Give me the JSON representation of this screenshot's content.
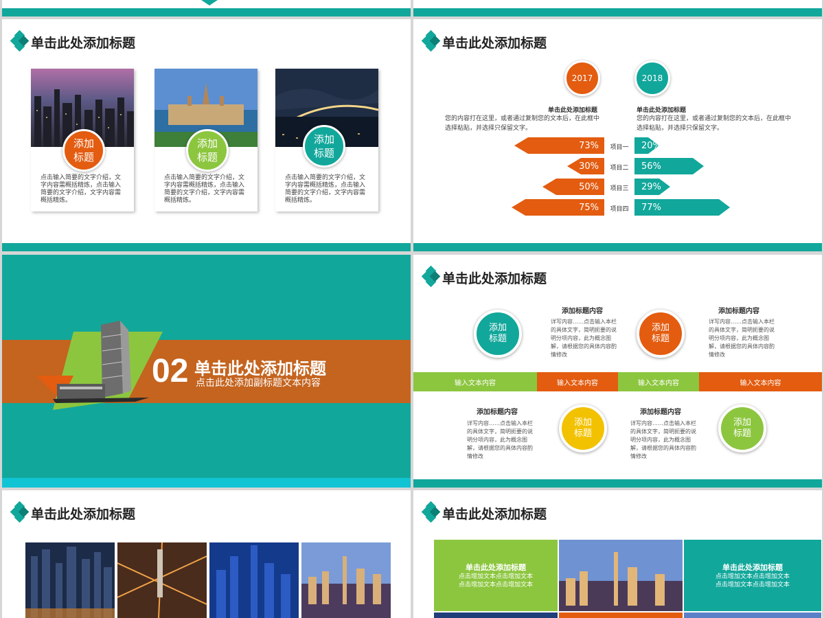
{
  "slide_title": "单击此处添加标题",
  "cards": [
    {
      "badge": "添加\n标题",
      "color": "#e35c10",
      "text": "点击输入简要的文字介绍，文字内容需概括精炼，点击输入简要的文字介绍，文字内容需概括精炼。"
    },
    {
      "badge": "添加\n标题",
      "color": "#8cc63f",
      "text": "点击输入简要的文字介绍，文字内容需概括精炼，点击输入简要的文字介绍，文字内容需概括精炼。"
    },
    {
      "badge": "添加\n标题",
      "color": "#12a79b",
      "text": "点击输入简要的文字介绍，文字内容需概括精炼，点击输入简要的文字介绍，文字内容需概括精炼。"
    }
  ],
  "compare": {
    "year_left": "2017",
    "year_right": "2018",
    "left_title": "单击此处添加标题",
    "right_title": "单击此处添加标题",
    "left_text": "您的内容打在这里，或者通过复制您的文本后，在此框中选择粘贴，并选择只保留文字。",
    "right_text": "您的内容打在这里，或者通过复制您的文本后，在此框中选择粘贴，并选择只保留文字。",
    "items": [
      {
        "label": "项目一",
        "left": "73%",
        "right": "20%"
      },
      {
        "label": "项目二",
        "left": "30%",
        "right": "56%"
      },
      {
        "label": "项目三",
        "left": "50%",
        "right": "29%"
      },
      {
        "label": "项目四",
        "left": "75%",
        "right": "77%"
      }
    ]
  },
  "section": {
    "number": "02",
    "title": "单击此处添加标题",
    "subtitle": "点击此处添加副标题文本内容"
  },
  "timeline": {
    "segment_label": "输入文本内容",
    "segments": [
      "输入文本内容",
      "输入文本内容",
      "输入文本内容",
      "输入文本内容"
    ],
    "nodes": [
      {
        "badge": "添加\n标题",
        "color": "#12a79b",
        "head": "添加标题内容",
        "text": "详写内容……点击输入本栏的具体文字，简明扼要的说明分项内容，此为概念图解，请根据您的具体内容酌情修改"
      },
      {
        "badge": "添加\n标题",
        "color": "#e35c10",
        "head": "添加标题内容",
        "text": "详写内容……点击输入本栏的具体文字，简明扼要的说明分项内容，此为概念图解，请根据您的具体内容酌情修改"
      },
      {
        "badge": "添加\n标题",
        "color": "#f2c200",
        "head": "添加标题内容",
        "text": "详写内容……点击输入本栏的具体文字，简明扼要的说明分项内容，此为概念图解，请根据您的具体内容酌情修改"
      },
      {
        "badge": "添加\n标题",
        "color": "#8cc63f",
        "head": "添加标题内容",
        "text": "详写内容……点击输入本栏的具体文字，简明扼要的说明分项内容，此为概念图解，请根据您的具体内容酌情修改"
      }
    ]
  },
  "tiles": {
    "title": "单击此处添加标题",
    "body": "点击增加文本点击增加文本\n点击增加文本点击增加文本"
  }
}
